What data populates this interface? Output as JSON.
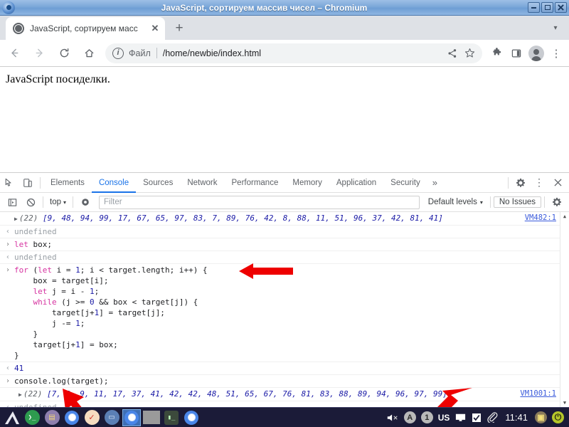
{
  "window": {
    "title": "JavaScript, сортируем массив чисел – Chromium",
    "logo_icon": "chromium-logo-icon",
    "buttons": [
      {
        "name": "minimize-button",
        "label": "–"
      },
      {
        "name": "maximize-button",
        "label": "□"
      },
      {
        "name": "close-button",
        "label": "✖"
      }
    ]
  },
  "tabstrip": {
    "tab_title": "JavaScript, сортируем масс",
    "tab_favicon": "globe-icon",
    "close_label": "✕",
    "newtab_label": "+",
    "chevron_label": "▾"
  },
  "toolbar": {
    "back_label": "←",
    "forward_label": "→",
    "reload_label": "⟳",
    "home_label": "⌂",
    "info_label": "i",
    "scheme_text": "Файл",
    "url": "/home/newbie/index.html",
    "share_label": "⋖",
    "star_label": "☆",
    "extensions_label": "🧩",
    "sidepanel_label": "▯",
    "menu_label": "⋮"
  },
  "page": {
    "heading": "JavaScript посиделки."
  },
  "devtools": {
    "inspect_icon": "inspect-element-icon",
    "device_icon": "device-toolbar-icon",
    "tabs": [
      {
        "label": "Elements",
        "active": false
      },
      {
        "label": "Console",
        "active": true
      },
      {
        "label": "Sources",
        "active": false
      },
      {
        "label": "Network",
        "active": false
      },
      {
        "label": "Performance",
        "active": false
      },
      {
        "label": "Memory",
        "active": false
      },
      {
        "label": "Application",
        "active": false
      },
      {
        "label": "Security",
        "active": false
      }
    ],
    "overflow_label": "»",
    "settings_label": "✷",
    "more_label": "⋮",
    "close_label": "✕",
    "console_toolbar": {
      "sidebar_label": "▣",
      "clear_label": "⊘",
      "context": "top",
      "context_caret": "▾",
      "eye_label": "◉",
      "filter_placeholder": "Filter",
      "levels": "Default levels",
      "levels_caret": "▾",
      "issues": "No Issues",
      "settings_label": "✷"
    },
    "console_rows": [
      {
        "type": "output-array",
        "gutter": "",
        "triangle": "▶",
        "length": "(22)",
        "values": "[9, 48, 94, 99, 17, 67, 65, 97, 83, 7, 89, 76, 42, 8, 88, 11, 51, 96, 37, 42, 81, 41]",
        "source": "VM482:1"
      },
      {
        "type": "result-undefined",
        "gutter": "‹",
        "text": "undefined"
      },
      {
        "type": "input",
        "gutter": "›",
        "keyword": "let",
        "rest": " box;"
      },
      {
        "type": "result-undefined",
        "gutter": "‹",
        "text": "undefined"
      },
      {
        "type": "input-code",
        "gutter": "›",
        "code": "for (let i = 1; i < target.length; i++) {\n    box = target[i];\n    let j = i - 1;\n    while (j >= 0 && box < target[j]) {\n        target[j+1] = target[j];\n        j -= 1;\n    }\n    target[j+1] = box;\n}"
      },
      {
        "type": "result-number",
        "gutter": "‹",
        "text": "41"
      },
      {
        "type": "input-plain",
        "gutter": "›",
        "text": "console.log(target);"
      },
      {
        "type": "output-array",
        "gutter": "",
        "triangle": "▶",
        "length": "(22)",
        "values": "[7, 8, 9, 11, 17, 37, 41, 42, 42, 48, 51, 65, 67, 76, 81, 83, 88, 89, 94, 96, 97, 99]",
        "source": "VM1001:1"
      },
      {
        "type": "result-undefined",
        "gutter": "‹",
        "text": "undefined"
      }
    ],
    "scrollbar": {
      "up": "▲",
      "down": "▼"
    }
  },
  "annotations": [
    {
      "name": "arrow-pointing-to-for-loop",
      "direction": "left"
    },
    {
      "name": "arrow-pointing-to-array-start",
      "direction": "up-left"
    },
    {
      "name": "arrow-pointing-to-array-end",
      "direction": "up-right"
    }
  ],
  "taskbar": {
    "launchers": [
      {
        "name": "taskbar-menu-icon",
        "kind": "arrow"
      },
      {
        "name": "taskbar-terminal-green-icon",
        "kind": "circle",
        "color": "#2e9b4f",
        "glyph": "❯_"
      },
      {
        "name": "taskbar-files-icon",
        "kind": "circle",
        "color": "#8f7fae",
        "glyph": "▤"
      },
      {
        "name": "taskbar-chromium-icon",
        "kind": "chromium"
      },
      {
        "name": "taskbar-notes-icon",
        "kind": "circle",
        "color": "#f6dcc0",
        "glyph": "✓"
      },
      {
        "name": "taskbar-window-icon",
        "kind": "circle",
        "color": "#5b7fb5",
        "glyph": "▭"
      },
      {
        "name": "taskbar-chromium-active-icon",
        "kind": "chromium",
        "selected": true
      },
      {
        "name": "taskbar-hidden-window-icon",
        "kind": "graybox"
      },
      {
        "name": "taskbar-terminal-icon",
        "kind": "sq",
        "color": "#3c4a3c",
        "glyph": "▮_"
      },
      {
        "name": "taskbar-chromium-window-icon",
        "kind": "chromium"
      }
    ],
    "tray": [
      {
        "name": "volume-muted-icon",
        "glyph": "🔇"
      },
      {
        "name": "accessibility-icon",
        "glyph": "A"
      },
      {
        "name": "workspace-icon",
        "glyph": "1"
      },
      {
        "name": "keyboard-layout-indicator",
        "glyph": "US"
      },
      {
        "name": "display-icon",
        "glyph": "▭"
      },
      {
        "name": "checkbox-icon",
        "glyph": "☑"
      },
      {
        "name": "clipboard-icon",
        "glyph": "📎"
      }
    ],
    "clock": "11:41",
    "right_icons": [
      {
        "name": "display-settings-icon",
        "glyph": "▣"
      },
      {
        "name": "logout-power-icon",
        "glyph": "⏻"
      }
    ]
  },
  "colors": {
    "titlebar": "#7ba7d9",
    "accent": "#1a73e8",
    "array_blue": "#1a1aa6",
    "keyword_pink": "#d633a0",
    "arrow_red": "#ee0000",
    "taskbar_bg": "#1b1b38"
  }
}
